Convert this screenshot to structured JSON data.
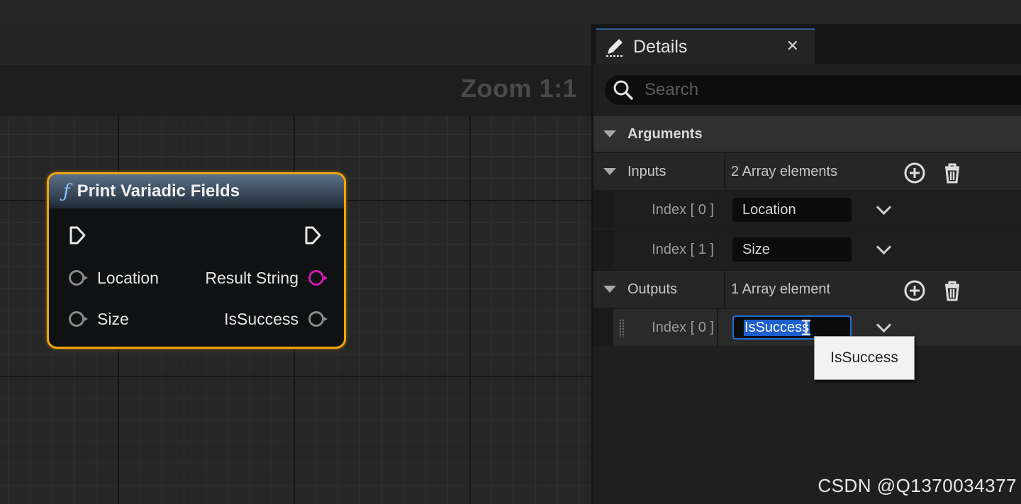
{
  "graph": {
    "zoom_label": "Zoom 1:1",
    "node": {
      "title": "Print Variadic Fields",
      "inputs": [
        "Location",
        "Size"
      ],
      "outputs": [
        "Result String",
        "IsSuccess"
      ]
    }
  },
  "details": {
    "tab_title": "Details",
    "search_placeholder": "Search",
    "section": "Arguments",
    "inputs": {
      "label": "Inputs",
      "count_text": "2 Array elements",
      "items": [
        {
          "index_label": "Index [ 0 ]",
          "value": "Location"
        },
        {
          "index_label": "Index [ 1 ]",
          "value": "Size"
        }
      ]
    },
    "outputs": {
      "label": "Outputs",
      "count_text": "1 Array element",
      "items": [
        {
          "index_label": "Index [ 0 ]",
          "value": "IsSuccess"
        }
      ]
    },
    "tooltip": "IsSuccess"
  },
  "watermark": "CSDN @Q1370034377",
  "colors": {
    "node_border": "#f2a50c",
    "selection": "#1d5fcc",
    "string_pin": "#d01ab4"
  }
}
